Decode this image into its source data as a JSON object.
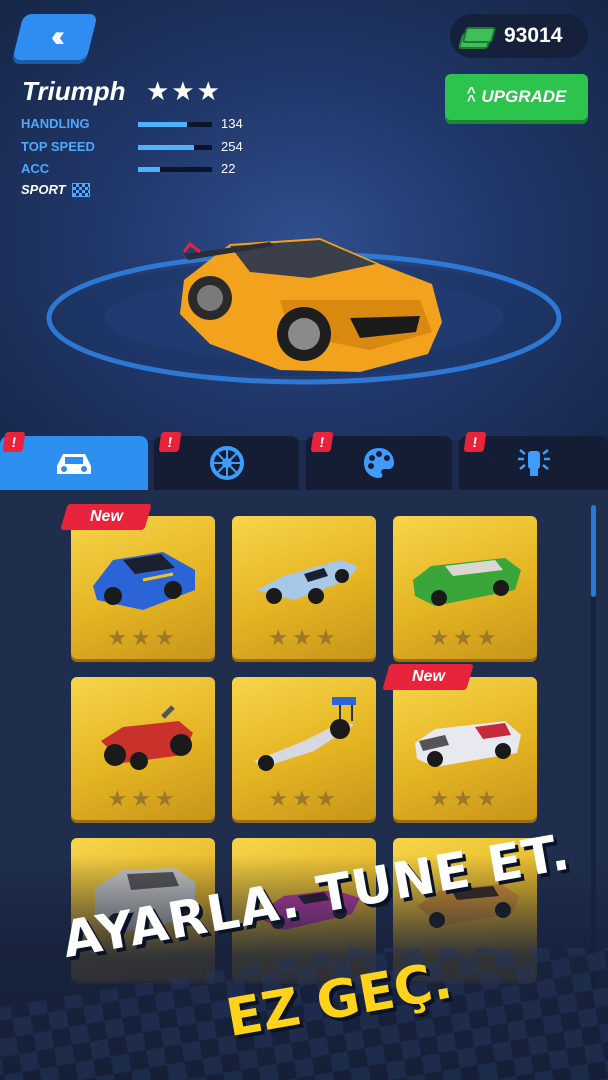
{
  "header": {
    "back_icon": "double-chevron-left-icon",
    "currency": "93014",
    "currency_icon": "cash-stack-icon",
    "upgrade_label": "UPGRADE",
    "upgrade_icon": "double-chevron-up-icon"
  },
  "car": {
    "name": "Triumph",
    "stars": "★★★",
    "stats": [
      {
        "label": "HANDLING",
        "value": "134",
        "level": 0.66
      },
      {
        "label": "TOP SPEED",
        "value": "254",
        "level": 0.75
      },
      {
        "label": "ACC",
        "value": "22",
        "level": 0.3
      }
    ],
    "class_label": "SPORT",
    "class_icon": "checkered-flag-icon",
    "color": "#f2a21c"
  },
  "tabs": [
    {
      "icon": "car-icon",
      "active": true,
      "badge": "!"
    },
    {
      "icon": "wheel-icon",
      "active": false,
      "badge": "!"
    },
    {
      "icon": "palette-icon",
      "active": false,
      "badge": "!"
    },
    {
      "icon": "underglow-icon",
      "active": false,
      "badge": "!"
    }
  ],
  "cars": [
    {
      "tag": "New",
      "stars": "★★★",
      "color": "#2a64d6"
    },
    {
      "tag": "",
      "stars": "★★★",
      "color": "#a8c8e8"
    },
    {
      "tag": "",
      "stars": "★★★",
      "color": "#3aa63a"
    },
    {
      "tag": "",
      "stars": "★★★",
      "color": "#c8322a"
    },
    {
      "tag": "",
      "stars": "★★★",
      "color": "#d8d8e0"
    },
    {
      "tag": "New",
      "stars": "★★★",
      "color": "#e8e8f0"
    },
    {
      "tag": "",
      "stars": "",
      "color": "#c8c8c0"
    },
    {
      "tag": "",
      "stars": "",
      "color": "#c03aa0"
    },
    {
      "tag": "",
      "stars": "",
      "color": "#d8932a"
    }
  ],
  "slogan": {
    "line1": "AYARLA. TUNE ET.",
    "line2": "EZ GEÇ."
  }
}
